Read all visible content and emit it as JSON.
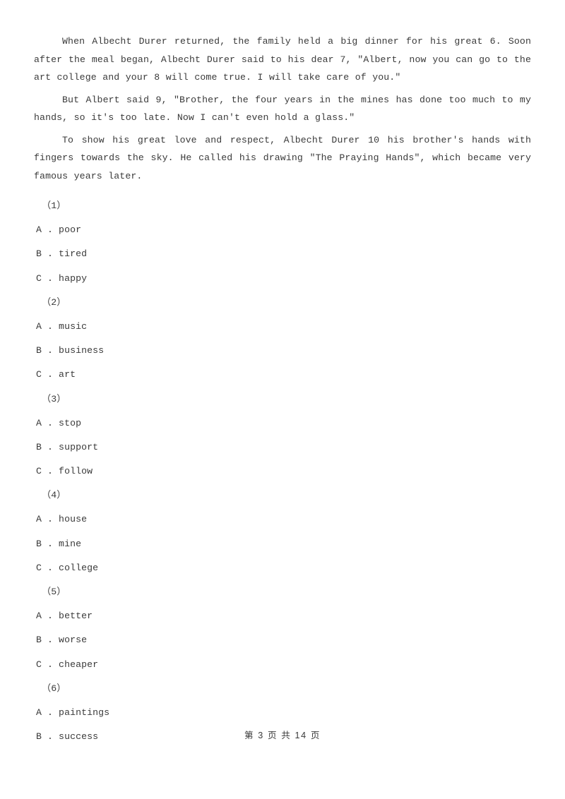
{
  "document": {
    "paragraphs": [
      "When Albecht Durer returned, the family held a big dinner for his great 6. Soon after the meal began, Albecht Durer said to his dear 7, \"Albert, now you can go to the art college and your 8 will come true. I will take care of you.\"",
      "But Albert said 9, \"Brother, the four years in the mines has done too much to my hands, so it's too late. Now I can't even hold a glass.\"",
      "To show his great love and respect, Albecht Durer 10 his brother's hands with fingers towards the sky. He called his drawing \"The Praying Hands\", which became very famous years later."
    ],
    "questions": [
      {
        "number": "（1）",
        "options": [
          "A . poor",
          "B . tired",
          "C . happy"
        ]
      },
      {
        "number": "（2）",
        "options": [
          "A . music",
          "B . business",
          "C . art"
        ]
      },
      {
        "number": "（3）",
        "options": [
          "A . stop",
          "B . support",
          "C . follow"
        ]
      },
      {
        "number": "（4）",
        "options": [
          "A . house",
          "B . mine",
          "C . college"
        ]
      },
      {
        "number": "（5）",
        "options": [
          "A . better",
          "B . worse",
          "C . cheaper"
        ]
      },
      {
        "number": "（6）",
        "options": [
          "A . paintings",
          "B . success"
        ]
      }
    ],
    "footer": "第 3 页 共 14 页"
  }
}
